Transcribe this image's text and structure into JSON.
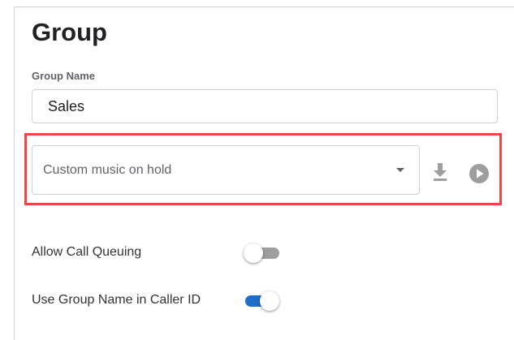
{
  "page": {
    "title": "Group"
  },
  "group_name": {
    "label": "Group Name",
    "value": "Sales"
  },
  "music_on_hold": {
    "placeholder": "Custom music on hold",
    "download_icon": "download-icon",
    "play_icon": "play-circle-icon"
  },
  "toggles": [
    {
      "label": "Allow Call Queuing",
      "on": false
    },
    {
      "label": "Use Group Name in Caller ID",
      "on": true
    }
  ],
  "colors": {
    "highlight": "#e94849",
    "toggle_on": "#1e6fc8",
    "toggle_off": "#9e9e9e",
    "icon": "#9e9e9e"
  }
}
